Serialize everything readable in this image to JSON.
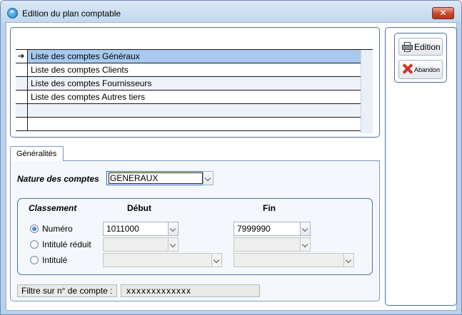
{
  "window": {
    "title": "Edition du plan comptable",
    "close_glyph": "✕"
  },
  "list": {
    "rows": [
      {
        "label": "Liste des comptes Généraux",
        "selected": true
      },
      {
        "label": "Liste des comptes Clients",
        "selected": false
      },
      {
        "label": "Liste des comptes Fournisseurs",
        "selected": false
      },
      {
        "label": "Liste des comptes Autres tiers",
        "selected": false
      },
      {
        "label": "",
        "selected": false
      },
      {
        "label": "",
        "selected": false
      }
    ],
    "current_row_marker": "➔"
  },
  "tabs": {
    "generalites": "Généralités"
  },
  "nature": {
    "label": "Nature des comptes",
    "value": "GENERAUX"
  },
  "classement": {
    "title": "Classement",
    "debut_header": "Début",
    "fin_header": "Fin",
    "options": [
      {
        "label": "Numéro",
        "selected": true,
        "debut": "1011000",
        "fin": "7999990"
      },
      {
        "label": "Intitulé réduit",
        "selected": false,
        "debut": "",
        "fin": ""
      },
      {
        "label": "Intitulé",
        "selected": false,
        "debut": "",
        "fin": ""
      }
    ]
  },
  "filter": {
    "label": "Filtre sur n° de compte :",
    "value": "xxxxxxxxxxxxx"
  },
  "actions": {
    "edition": "Edition",
    "abandon": "Abandon"
  },
  "colors": {
    "selected_row": "#a9c9ee",
    "frame_bg": "#b9d1ea",
    "panel_border": "#4f6f9b",
    "close_red": "#c7462d"
  },
  "icons": {
    "app": "app-icon",
    "edition": "printer-icon",
    "abandon": "red-x-icon"
  }
}
